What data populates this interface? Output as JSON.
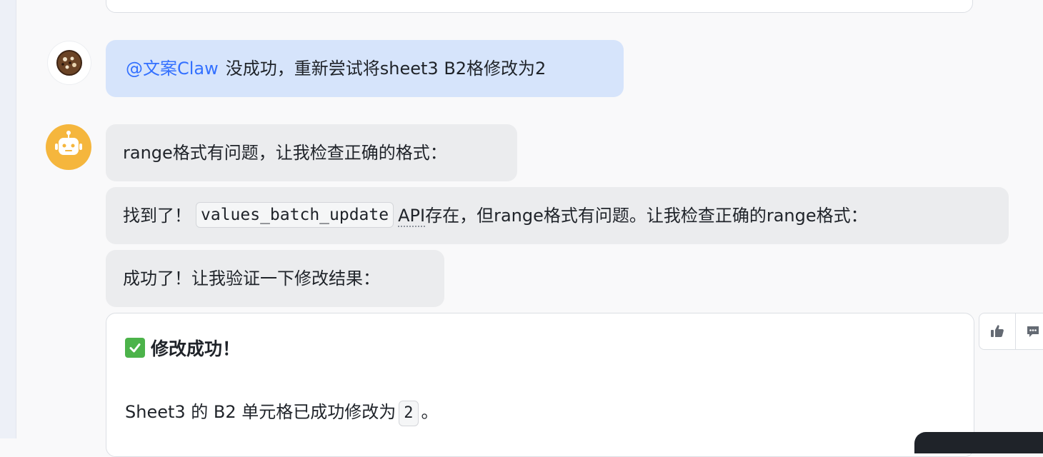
{
  "messages": {
    "user": {
      "mention": "@文案Claw",
      "text": "没成功，重新尝试将sheet3 B2格修改为2"
    },
    "bot_1": {
      "text": "range格式有问题，让我检查正确的格式："
    },
    "bot_2": {
      "prefix": "找到了！",
      "code": "values_batch_update",
      "api": "API",
      "suffix": "存在，但range格式有问题。让我检查正确的range格式："
    },
    "bot_3": {
      "text": "成功了！让我验证一下修改结果："
    }
  },
  "result": {
    "title": "修改成功！",
    "line_prefix": "Sheet3 的 B2 单元格已成功修改为",
    "value": "2",
    "line_suffix": "。"
  },
  "icons": {
    "user_avatar": "cookie-avatar-icon",
    "bot_avatar": "robot-avatar-icon",
    "check": "check-mark-icon",
    "like": "thumbs-up-icon",
    "comment": "comment-icon"
  },
  "colors": {
    "mention": "#3370ff",
    "user_bubble": "#d6e4fb",
    "bot_bubble": "#ebecee",
    "bot_avatar_bg": "#f5b63d",
    "check_green": "#4cb34a"
  }
}
